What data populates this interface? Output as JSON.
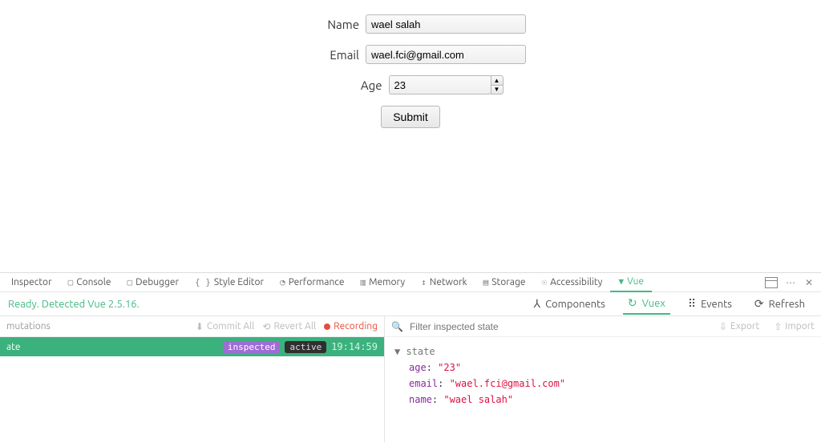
{
  "form": {
    "name_label": "Name",
    "name_value": "wael salah",
    "email_label": "Email",
    "email_value": "wael.fci@gmail.com",
    "age_label": "Age",
    "age_value": "23",
    "submit_label": "Submit"
  },
  "devtools_tabs": {
    "inspector": "Inspector",
    "console": "Console",
    "debugger": "Debugger",
    "style_editor": "Style Editor",
    "performance": "Performance",
    "memory": "Memory",
    "network": "Network",
    "storage": "Storage",
    "accessibility": "Accessibility",
    "vue": "Vue"
  },
  "vue_status": "Ready. Detected Vue 2.5.16.",
  "vue_tools": {
    "components": "Components",
    "vuex": "Vuex",
    "events": "Events",
    "refresh": "Refresh"
  },
  "mutations": {
    "header": "mutations",
    "commit_all": "Commit All",
    "revert_all": "Revert All",
    "recording": "Recording",
    "row_label": "ate",
    "inspected": "inspected",
    "active": "active",
    "time": "19:14:59"
  },
  "inspector": {
    "filter_placeholder": "Filter inspected state",
    "export": "Export",
    "import": "Import",
    "state_header": "state",
    "state": {
      "age_key": "age",
      "age_val": "\"23\"",
      "email_key": "email",
      "email_val": "\"wael.fci@gmail.com\"",
      "name_key": "name",
      "name_val": "\"wael salah\""
    }
  }
}
